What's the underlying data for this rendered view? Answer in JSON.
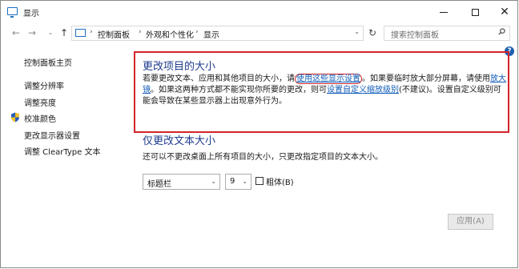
{
  "window": {
    "title": "显示",
    "app_icon": "monitor-icon",
    "controls": {
      "minimize": "minimize-icon",
      "maximize": "maximize-icon",
      "close": "✕"
    }
  },
  "navbar": {
    "back": "←",
    "forward": "→",
    "recent": "⌄",
    "up": "↑",
    "breadcrumb": [
      "控制面板",
      "外观和个性化",
      "显示"
    ],
    "separator": "›",
    "dropdown": "⌄",
    "refresh": "↻",
    "search_placeholder": "搜索控制面板"
  },
  "sidebar": {
    "items": [
      {
        "label": "控制面板主页"
      },
      {
        "label": "调整分辨率"
      },
      {
        "label": "调整亮度"
      },
      {
        "label": "校准颜色",
        "icon": "shield-icon"
      },
      {
        "label": "更改显示器设置"
      },
      {
        "label": "调整 ClearType 文本"
      }
    ]
  },
  "help": "?",
  "main": {
    "heading1": "更改项目的大小",
    "para": {
      "part1": "若要更改文本、应用和其他项目的大小，请",
      "link1": "使用这些显示设置",
      "part2": "。如果要临时放大部分屏幕，请使用",
      "link2": "放大镜",
      "part3": "。如果这两种方式都不能实现你所要的更改，则可",
      "link3": "设置自定义缩放级别",
      "part4": "(不建议)。设置自定义级别可能会导致在某些显示器上出现意外行为。"
    },
    "heading2": "仅更改文本大小",
    "desc2": "还可以不更改桌面上所有项目的大小，只更改指定项目的文本大小。",
    "item_select": {
      "value": "标题栏",
      "arrow": "⌄"
    },
    "size_select": {
      "value": "9",
      "arrow": "⌄"
    },
    "bold_label": "粗体(B)",
    "bold_checked": false,
    "apply_label": "应用(A)",
    "colors": {
      "link": "#0f5cb8",
      "heading": "#1e3a8c",
      "highlight": "#d1252c"
    }
  }
}
